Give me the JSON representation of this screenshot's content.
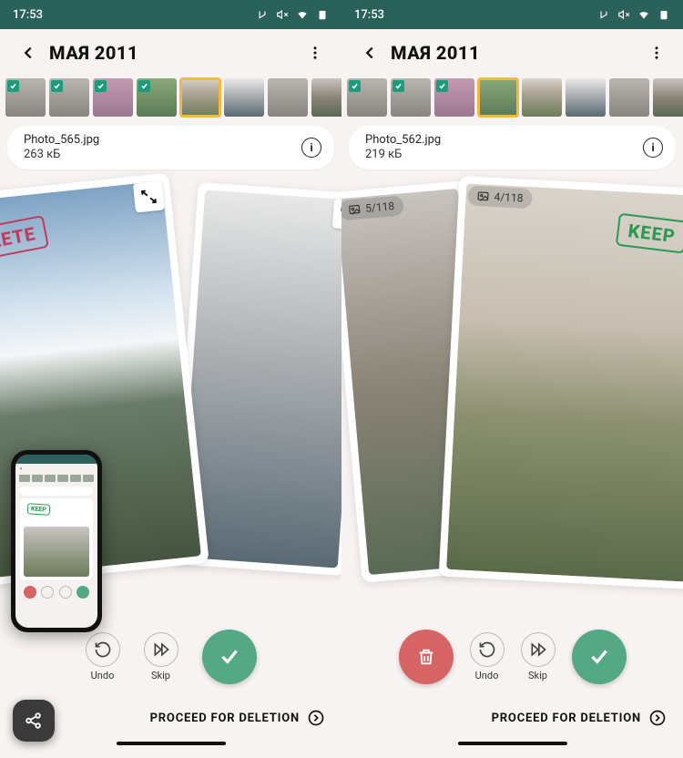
{
  "left": {
    "status": {
      "time": "17:53"
    },
    "header": {
      "title": "МАЯ 2011"
    },
    "info": {
      "filename": "Photo_565.jpg",
      "filesize": "263 кБ"
    },
    "stamp": {
      "label": "DELETE",
      "kind": "delete"
    },
    "actions": {
      "undo": "Undo",
      "skip": "Skip"
    },
    "proceed": "PROCEED FOR DELETION"
  },
  "right": {
    "status": {
      "time": "17:53"
    },
    "header": {
      "title": "МАЯ 2011"
    },
    "info": {
      "filename": "Photo_562.jpg",
      "filesize": "219 кБ"
    },
    "stamp": {
      "label": "KEEP",
      "kind": "keep"
    },
    "counters": {
      "back": "5/118",
      "front": "4/118"
    },
    "actions": {
      "undo": "Undo",
      "skip": "Skip"
    },
    "proceed": "PROCEED FOR DELETION"
  },
  "mini": {
    "stamp": "KEEP"
  }
}
